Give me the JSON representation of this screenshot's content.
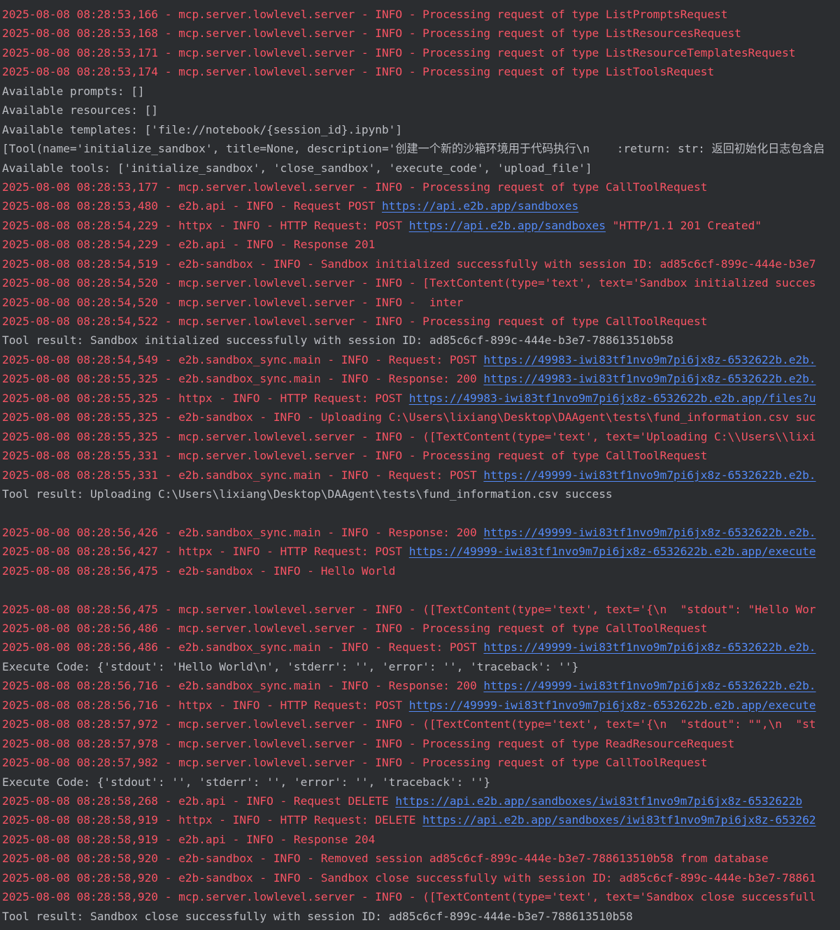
{
  "colors": {
    "background": "#2b2d30",
    "stderr_log": "#f75464",
    "stdout": "#bcbec4",
    "link": "#548af7"
  },
  "lines": [
    {
      "kind": "log",
      "segments": [
        {
          "t": "2025-08-08 08:28:53,166 - mcp.server.lowlevel.server - INFO - Processing request of type ListPromptsRequest"
        }
      ]
    },
    {
      "kind": "log",
      "segments": [
        {
          "t": "2025-08-08 08:28:53,168 - mcp.server.lowlevel.server - INFO - Processing request of type ListResourcesRequest"
        }
      ]
    },
    {
      "kind": "log",
      "segments": [
        {
          "t": "2025-08-08 08:28:53,171 - mcp.server.lowlevel.server - INFO - Processing request of type ListResourceTemplatesRequest"
        }
      ]
    },
    {
      "kind": "log",
      "segments": [
        {
          "t": "2025-08-08 08:28:53,174 - mcp.server.lowlevel.server - INFO - Processing request of type ListToolsRequest"
        }
      ]
    },
    {
      "kind": "out",
      "segments": [
        {
          "t": "Available prompts: []"
        }
      ]
    },
    {
      "kind": "out",
      "segments": [
        {
          "t": "Available resources: []"
        }
      ]
    },
    {
      "kind": "out",
      "segments": [
        {
          "t": "Available templates: ['file://notebook/{session_id}.ipynb']"
        }
      ]
    },
    {
      "kind": "out",
      "segments": [
        {
          "t": "[Tool(name='initialize_sandbox', title=None, description='创建一个新的沙箱环境用于代码执行\\n    :return: str: 返回初始化日志包含启"
        }
      ]
    },
    {
      "kind": "out",
      "segments": [
        {
          "t": "Available tools: ['initialize_sandbox', 'close_sandbox', 'execute_code', 'upload_file']"
        }
      ]
    },
    {
      "kind": "log",
      "segments": [
        {
          "t": "2025-08-08 08:28:53,177 - mcp.server.lowlevel.server - INFO - Processing request of type CallToolRequest"
        }
      ]
    },
    {
      "kind": "log",
      "segments": [
        {
          "t": "2025-08-08 08:28:53,480 - e2b.api - INFO - Request POST "
        },
        {
          "t": "https://api.e2b.app/sandboxes",
          "link": true
        }
      ]
    },
    {
      "kind": "log",
      "segments": [
        {
          "t": "2025-08-08 08:28:54,229 - httpx - INFO - HTTP Request: POST "
        },
        {
          "t": "https://api.e2b.app/sandboxes",
          "link": true
        },
        {
          "t": " \"HTTP/1.1 201 Created\""
        }
      ]
    },
    {
      "kind": "log",
      "segments": [
        {
          "t": "2025-08-08 08:28:54,229 - e2b.api - INFO - Response 201"
        }
      ]
    },
    {
      "kind": "log",
      "segments": [
        {
          "t": "2025-08-08 08:28:54,519 - e2b-sandbox - INFO - Sandbox initialized successfully with session ID: ad85c6cf-899c-444e-b3e7"
        }
      ]
    },
    {
      "kind": "log",
      "segments": [
        {
          "t": "2025-08-08 08:28:54,520 - mcp.server.lowlevel.server - INFO - [TextContent(type='text', text='Sandbox initialized succes"
        }
      ]
    },
    {
      "kind": "log",
      "segments": [
        {
          "t": "2025-08-08 08:28:54,520 - mcp.server.lowlevel.server - INFO -  inter"
        }
      ]
    },
    {
      "kind": "log",
      "segments": [
        {
          "t": "2025-08-08 08:28:54,522 - mcp.server.lowlevel.server - INFO - Processing request of type CallToolRequest"
        }
      ]
    },
    {
      "kind": "out",
      "segments": [
        {
          "t": "Tool result: Sandbox initialized successfully with session ID: ad85c6cf-899c-444e-b3e7-788613510b58"
        }
      ]
    },
    {
      "kind": "log",
      "segments": [
        {
          "t": "2025-08-08 08:28:54,549 - e2b.sandbox_sync.main - INFO - Request: POST "
        },
        {
          "t": "https://49983-iwi83tf1nvo9m7pi6jx8z-6532622b.e2b.",
          "link": true
        }
      ]
    },
    {
      "kind": "log",
      "segments": [
        {
          "t": "2025-08-08 08:28:55,325 - e2b.sandbox_sync.main - INFO - Response: 200 "
        },
        {
          "t": "https://49983-iwi83tf1nvo9m7pi6jx8z-6532622b.e2b.",
          "link": true
        }
      ]
    },
    {
      "kind": "log",
      "segments": [
        {
          "t": "2025-08-08 08:28:55,325 - httpx - INFO - HTTP Request: POST "
        },
        {
          "t": "https://49983-iwi83tf1nvo9m7pi6jx8z-6532622b.e2b.app/files?u",
          "link": true
        }
      ]
    },
    {
      "kind": "log",
      "segments": [
        {
          "t": "2025-08-08 08:28:55,325 - e2b-sandbox - INFO - Uploading C:\\Users\\lixiang\\Desktop\\DAAgent\\tests\\fund_information.csv suc"
        }
      ]
    },
    {
      "kind": "log",
      "segments": [
        {
          "t": "2025-08-08 08:28:55,325 - mcp.server.lowlevel.server - INFO - ([TextContent(type='text', text='Uploading C:\\\\Users\\\\lixi"
        }
      ]
    },
    {
      "kind": "log",
      "segments": [
        {
          "t": "2025-08-08 08:28:55,331 - mcp.server.lowlevel.server - INFO - Processing request of type CallToolRequest"
        }
      ]
    },
    {
      "kind": "log",
      "segments": [
        {
          "t": "2025-08-08 08:28:55,331 - e2b.sandbox_sync.main - INFO - Request: POST "
        },
        {
          "t": "https://49999-iwi83tf1nvo9m7pi6jx8z-6532622b.e2b.",
          "link": true
        }
      ]
    },
    {
      "kind": "out",
      "segments": [
        {
          "t": "Tool result: Uploading C:\\Users\\lixiang\\Desktop\\DAAgent\\tests\\fund_information.csv success"
        }
      ]
    },
    {
      "kind": "out",
      "segments": [
        {
          "t": ""
        }
      ]
    },
    {
      "kind": "log",
      "segments": [
        {
          "t": "2025-08-08 08:28:56,426 - e2b.sandbox_sync.main - INFO - Response: 200 "
        },
        {
          "t": "https://49999-iwi83tf1nvo9m7pi6jx8z-6532622b.e2b.",
          "link": true
        }
      ]
    },
    {
      "kind": "log",
      "segments": [
        {
          "t": "2025-08-08 08:28:56,427 - httpx - INFO - HTTP Request: POST "
        },
        {
          "t": "https://49999-iwi83tf1nvo9m7pi6jx8z-6532622b.e2b.app/execute",
          "link": true
        }
      ]
    },
    {
      "kind": "log",
      "segments": [
        {
          "t": "2025-08-08 08:28:56,475 - e2b-sandbox - INFO - Hello World"
        }
      ]
    },
    {
      "kind": "log",
      "segments": [
        {
          "t": ""
        }
      ]
    },
    {
      "kind": "log",
      "segments": [
        {
          "t": "2025-08-08 08:28:56,475 - mcp.server.lowlevel.server - INFO - ([TextContent(type='text', text='{\\n  \"stdout\": \"Hello Wor"
        }
      ]
    },
    {
      "kind": "log",
      "segments": [
        {
          "t": "2025-08-08 08:28:56,486 - mcp.server.lowlevel.server - INFO - Processing request of type CallToolRequest"
        }
      ]
    },
    {
      "kind": "log",
      "segments": [
        {
          "t": "2025-08-08 08:28:56,486 - e2b.sandbox_sync.main - INFO - Request: POST "
        },
        {
          "t": "https://49999-iwi83tf1nvo9m7pi6jx8z-6532622b.e2b.",
          "link": true
        }
      ]
    },
    {
      "kind": "out",
      "segments": [
        {
          "t": "Execute Code: {'stdout': 'Hello World\\n', 'stderr': '', 'error': '', 'traceback': ''}"
        }
      ]
    },
    {
      "kind": "log",
      "segments": [
        {
          "t": "2025-08-08 08:28:56,716 - e2b.sandbox_sync.main - INFO - Response: 200 "
        },
        {
          "t": "https://49999-iwi83tf1nvo9m7pi6jx8z-6532622b.e2b.",
          "link": true
        }
      ]
    },
    {
      "kind": "log",
      "segments": [
        {
          "t": "2025-08-08 08:28:56,716 - httpx - INFO - HTTP Request: POST "
        },
        {
          "t": "https://49999-iwi83tf1nvo9m7pi6jx8z-6532622b.e2b.app/execute",
          "link": true
        }
      ]
    },
    {
      "kind": "log",
      "segments": [
        {
          "t": "2025-08-08 08:28:57,972 - mcp.server.lowlevel.server - INFO - ([TextContent(type='text', text='{\\n  \"stdout\": \"\",\\n  \"st"
        }
      ]
    },
    {
      "kind": "log",
      "segments": [
        {
          "t": "2025-08-08 08:28:57,978 - mcp.server.lowlevel.server - INFO - Processing request of type ReadResourceRequest"
        }
      ]
    },
    {
      "kind": "log",
      "segments": [
        {
          "t": "2025-08-08 08:28:57,982 - mcp.server.lowlevel.server - INFO - Processing request of type CallToolRequest"
        }
      ]
    },
    {
      "kind": "out",
      "segments": [
        {
          "t": "Execute Code: {'stdout': '', 'stderr': '', 'error': '', 'traceback': ''}"
        }
      ]
    },
    {
      "kind": "log",
      "segments": [
        {
          "t": "2025-08-08 08:28:58,268 - e2b.api - INFO - Request DELETE "
        },
        {
          "t": "https://api.e2b.app/sandboxes/iwi83tf1nvo9m7pi6jx8z-6532622b",
          "link": true
        }
      ]
    },
    {
      "kind": "log",
      "segments": [
        {
          "t": "2025-08-08 08:28:58,919 - httpx - INFO - HTTP Request: DELETE "
        },
        {
          "t": "https://api.e2b.app/sandboxes/iwi83tf1nvo9m7pi6jx8z-653262",
          "link": true
        }
      ]
    },
    {
      "kind": "log",
      "segments": [
        {
          "t": "2025-08-08 08:28:58,919 - e2b.api - INFO - Response 204"
        }
      ]
    },
    {
      "kind": "log",
      "segments": [
        {
          "t": "2025-08-08 08:28:58,920 - e2b-sandbox - INFO - Removed session ad85c6cf-899c-444e-b3e7-788613510b58 from database"
        }
      ]
    },
    {
      "kind": "log",
      "segments": [
        {
          "t": "2025-08-08 08:28:58,920 - e2b-sandbox - INFO - Sandbox close successfully with session ID: ad85c6cf-899c-444e-b3e7-78861"
        }
      ]
    },
    {
      "kind": "log",
      "segments": [
        {
          "t": "2025-08-08 08:28:58,920 - mcp.server.lowlevel.server - INFO - ([TextContent(type='text', text='Sandbox close successfull"
        }
      ]
    },
    {
      "kind": "out",
      "segments": [
        {
          "t": "Tool result: Sandbox close successfully with session ID: ad85c6cf-899c-444e-b3e7-788613510b58"
        }
      ]
    }
  ]
}
